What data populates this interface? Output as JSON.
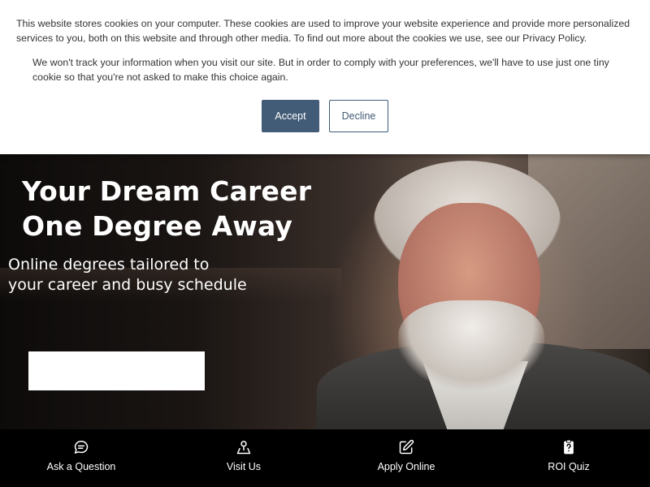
{
  "cookie_banner": {
    "text_primary": "This website stores cookies on your computer. These cookies are used to improve your website experience and provide more personalized services to you, both on this website and through other media. To find out more about the cookies we use, see our Privacy Policy.",
    "text_secondary": "We won't track your information when you visit our site. But in order to comply with your preferences, we'll have to use just one tiny cookie so that you're not asked to make this choice again.",
    "accept_label": "Accept",
    "decline_label": "Decline",
    "accent_color": "#425b76"
  },
  "hero": {
    "title_line1": "Your Dream Career",
    "title_line2": "One Degree Away",
    "subtitle_line1": "Online degrees tailored to",
    "subtitle_line2": "your career and busy schedule"
  },
  "bottom_bar": {
    "items": [
      {
        "label": "Ask a Question",
        "icon": "chat-bubble-icon"
      },
      {
        "label": "Visit Us",
        "icon": "map-pin-icon"
      },
      {
        "label": "Apply Online",
        "icon": "edit-icon"
      },
      {
        "label": "ROI Quiz",
        "icon": "clipboard-question-icon"
      }
    ]
  }
}
